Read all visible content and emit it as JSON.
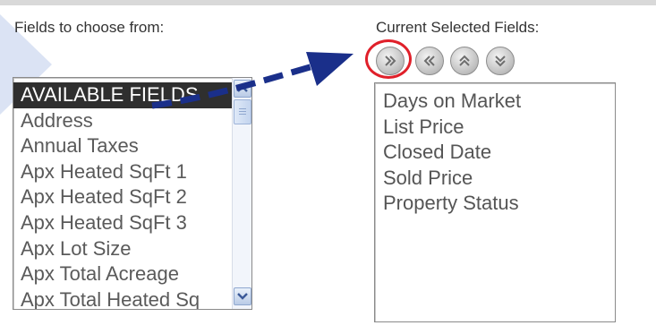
{
  "left_panel": {
    "heading": "Fields to choose from:",
    "items": [
      "AVAILABLE FIELDS",
      "Address",
      "Annual Taxes",
      "Apx Heated SqFt 1",
      "Apx Heated SqFt 2",
      "Apx Heated SqFt 3",
      "Apx Lot Size",
      "Apx Total Acreage",
      "Apx Total Heated Sq"
    ],
    "selected_index": 0
  },
  "right_panel": {
    "heading": "Current Selected Fields:",
    "items": [
      "Days on Market",
      "List Price",
      "Closed Date",
      "Sold Price",
      "Property Status"
    ]
  },
  "controls": [
    "add-icon",
    "remove-icon",
    "move-up-icon",
    "move-down-icon"
  ],
  "colors": {
    "highlight_ring": "#e0202a",
    "annotation_arrow": "#1a2f8a",
    "selected_item_bg": "#2f2f2f",
    "decorative_triangle": "#dbe3f4"
  }
}
